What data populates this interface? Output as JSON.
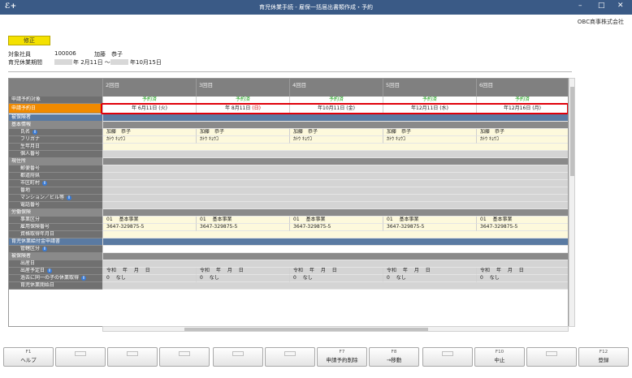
{
  "window": {
    "title": "育児休業手続 - 雇保一括届出書類作成・予約",
    "company": "OBC商事株式会社"
  },
  "toolbar": {
    "mode_label": "修正"
  },
  "employee": {
    "label": "対象社員",
    "code": "100006",
    "name": "加藤　恭子",
    "period_label": "育児休業期間",
    "period_start": "年 2月11日 ～",
    "period_end": "年10月15日"
  },
  "columns": [
    "2回目",
    "3回目",
    "4回目",
    "5回目",
    "6回目"
  ],
  "rows": {
    "status_label": "申請予約対象",
    "status_values": [
      "予約済",
      "予約済",
      "予約済",
      "予約済",
      "予約済"
    ],
    "date_label": "申請予約日",
    "dates": [
      {
        "date": "年  6月11日",
        "dow": "(火)",
        "holiday": false
      },
      {
        "date": "年  8月11日",
        "dow": "(日)",
        "holiday": true
      },
      {
        "date": "年10月11日",
        "dow": "(金)",
        "holiday": false
      },
      {
        "date": "年12月11日",
        "dow": "(水)",
        "holiday": false
      },
      {
        "date": "年12月16日",
        "dow": "(月)",
        "holiday": false
      }
    ],
    "insured_label": "被保険者",
    "basic_label": "基本情報",
    "name_label": "氏名",
    "names": [
      "加藤　恭子",
      "加藤　恭子",
      "加藤　恭子",
      "加藤　恭子",
      "加藤　恭子"
    ],
    "kana_label": "フリガナ",
    "kanas": [
      "ｶﾄｳ ｷｮｳｺ",
      "ｶﾄｳ ｷｮｳｺ",
      "ｶﾄｳ ｷｮｳｺ",
      "ｶﾄｳ ｷｮｳｺ",
      "ｶﾄｳ ｷｮｳｺ"
    ],
    "birth_label": "生年月日",
    "mynum_label": "個人番号",
    "address_label": "現住所",
    "zip_label": "郵便番号",
    "pref_label": "都道府県",
    "city_label": "市区町村",
    "street_label": "番地",
    "building_label": "マンション／ビル等",
    "phone_label": "電話番号",
    "labor_label": "労働保険",
    "office_label": "事業区分",
    "offices": [
      "01　 基本事業",
      "01　 基本事業",
      "01　 基本事業",
      "01　 基本事業",
      "01　 基本事業"
    ],
    "ins_no_label": "雇用保険番号",
    "ins_nos": [
      "3647-329875-5",
      "3647-329875-5",
      "3647-329875-5",
      "3647-329875-5",
      "3647-329875-5"
    ],
    "acq_label": "資格取得年月日",
    "benefit_label": "育児休業給付金申請書",
    "jurisdiction_label": "管轄区分",
    "insured2_label": "被保険者",
    "birthdate_label": "出産日",
    "due_label": "出産予定日",
    "due_values": [
      "令和　 年　 月　 日",
      "令和　 年　 月　 日",
      "令和　 年　 月　 日",
      "令和　 年　 月　 日",
      "令和　 年　 月　 日"
    ],
    "past_label": "過去に同一の子の休業取得",
    "past_values": [
      "0　 なし",
      "0　 なし",
      "0　 なし",
      "0　 なし",
      "0　 なし"
    ],
    "start_label": "育児休業開始日"
  },
  "fkeys": [
    {
      "key": "F1",
      "label": "ヘルプ"
    },
    {
      "key": "",
      "label": ""
    },
    {
      "key": "",
      "label": ""
    },
    {
      "key": "",
      "label": ""
    },
    {
      "key": "",
      "label": ""
    },
    {
      "key": "",
      "label": ""
    },
    {
      "key": "F7",
      "label": "申請予約削除"
    },
    {
      "key": "F8",
      "label": "→移動"
    },
    {
      "key": "",
      "label": ""
    },
    {
      "key": "F10",
      "label": "中止"
    },
    {
      "key": "",
      "label": ""
    },
    {
      "key": "F12",
      "label": "登録"
    }
  ]
}
